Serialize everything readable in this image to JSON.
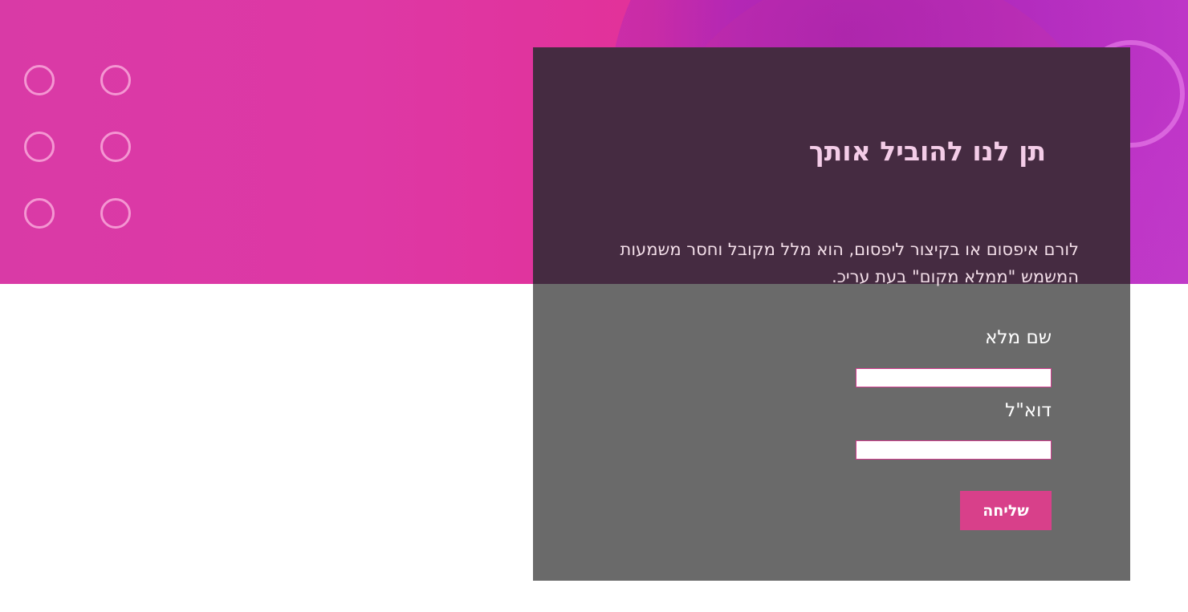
{
  "hero": {
    "colors": {
      "primary": "#de38a5",
      "secondary": "#bd2fc4"
    }
  },
  "form": {
    "title": "תן לנו להוביל אותך",
    "description": "לורם איפסום או בקיצור ליפסום, הוא מלל מקובל וחסר משמעות המשמש \"ממלא מקום\" בעת עריכ.",
    "fields": [
      {
        "label": "שם מלא",
        "value": ""
      },
      {
        "label": "דוא\"ל",
        "value": ""
      }
    ],
    "submit_label": "שליחה",
    "colors": {
      "button": "#d8408a",
      "panel": "#6a6a6a",
      "input_border": "#d23d8f"
    }
  }
}
